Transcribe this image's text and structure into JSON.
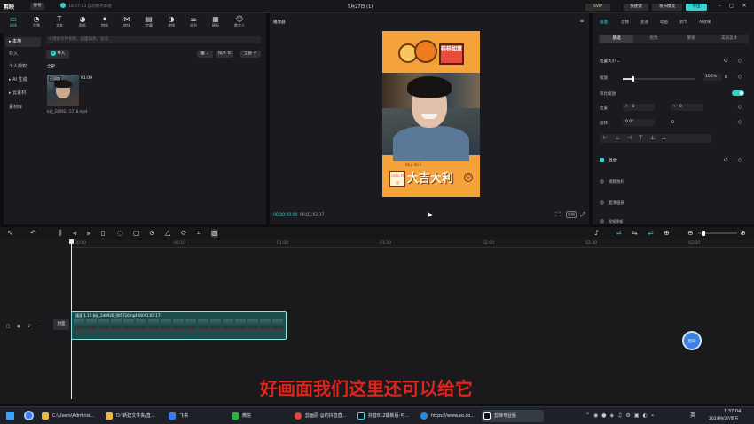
{
  "app": {
    "logo": "剪映",
    "account_label": "账号",
    "status_text": "18:37:53 自动保存本地",
    "project_title": "9月27日 (1)",
    "svip_label": "SVIP",
    "shortcut_label": "快捷键",
    "publish_label": "发布模板",
    "export_label": "导出"
  },
  "top_tabs": [
    {
      "label": "媒体",
      "icon": "▭"
    },
    {
      "label": "音频",
      "icon": "◔"
    },
    {
      "label": "文本",
      "icon": "T"
    },
    {
      "label": "贴纸",
      "icon": "◕"
    },
    {
      "label": "特效",
      "icon": "✦"
    },
    {
      "label": "转场",
      "icon": "⋈"
    },
    {
      "label": "字幕",
      "icon": "▤"
    },
    {
      "label": "滤镜",
      "icon": "◑"
    },
    {
      "label": "调节",
      "icon": "⚌"
    },
    {
      "label": "模板",
      "icon": "▦"
    },
    {
      "label": "数字人",
      "icon": "☺"
    }
  ],
  "left_nav": [
    {
      "label": "▸ 本地",
      "active": true
    },
    {
      "label": "导入"
    },
    {
      "label": "个人授权"
    },
    {
      "label": "▸ AI 生成"
    },
    {
      "label": "▸ 云素材"
    },
    {
      "label": "素材库"
    }
  ],
  "media_panel": {
    "search_placeholder": "搜索文件名称、画面描述、台词",
    "import_label": "导入",
    "sort_label": "排序",
    "all_label": "全部",
    "section_label": "全部",
    "clip": {
      "badge": "已添加",
      "duration": "01:09",
      "filename": "b站_24092...5718.mp4"
    }
  },
  "player": {
    "title": "播放器",
    "current_time": "00:00:00:00",
    "total_time": "00:01:02:17",
    "sticker_top": "桂桂如意",
    "sticker_bottom": "大吉大利",
    "sticker_percent": "100% 好运",
    "sticker_pinyin": "da  ji  da  li",
    "ratio_label": "比例"
  },
  "right_panel": {
    "tabs": [
      "画面",
      "音频",
      "变速",
      "动画",
      "调节",
      "AI效果"
    ],
    "subtabs": [
      "基础",
      "抠像",
      "蒙版",
      "美颜美体"
    ],
    "size_section": "位置大小 ⌄",
    "scale_label": "缩放",
    "scale_value": "100%",
    "scale_fraction": 0.14,
    "uniform_label": "等比缩放",
    "position_label": "位置",
    "pos_x_label": "X",
    "pos_x": "0",
    "pos_y_label": "Y",
    "pos_y": "0",
    "rotate_label": "旋转",
    "rotate_value": "0.0°",
    "blend_label": "混合",
    "stabilize_label": "视频防抖",
    "superres_label": "超清画质",
    "denoise_label": "视频降噪"
  },
  "timeline": {
    "ruler": [
      "00:00",
      "00:10",
      "01:00",
      "01:30",
      "02:00",
      "02:30",
      "03:00"
    ],
    "cover_label": "封面",
    "clip_label": "速速 1.1X  b站_240926_005716mp4  00:01:02:17",
    "float_label": "剪同"
  },
  "subtitle": "好画面我们这里还可以给它",
  "taskbar": {
    "items": [
      {
        "label": "C:\\Users\\Adminis...",
        "color": "#e8b84a"
      },
      {
        "label": "D:\\新建文件夹\\直...",
        "color": "#e8b84a"
      },
      {
        "label": "飞书",
        "color": "#3a7bf0"
      },
      {
        "label": "微信",
        "color": "#2ab24a"
      },
      {
        "label": "剪画原 @的抖音直...",
        "color": "#e0493a"
      },
      {
        "label": "抖音812爆新版-可...",
        "color": "#111111"
      },
      {
        "label": "https://www.so.co...",
        "color": "#2c8bd8"
      },
      {
        "label": "剪映专业版",
        "color": "#111111"
      }
    ],
    "ime": "英",
    "time": "1:37:04",
    "date": "2024/9/27/周五"
  },
  "colors": {
    "accent": "#35d3cf",
    "subtitle": "#e0241b",
    "sticker_orange": "#f39a2b"
  }
}
